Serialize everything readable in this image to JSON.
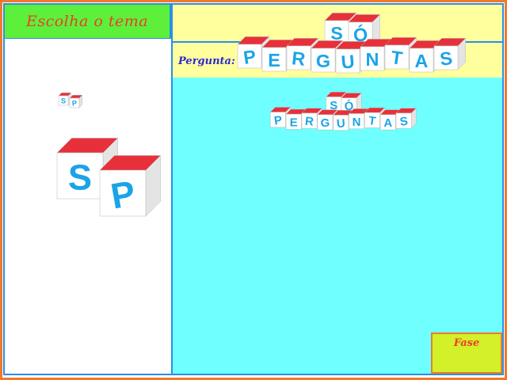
{
  "theme_button": {
    "label": "Escolha o tema"
  },
  "question": {
    "label": "Pergunta:",
    "text": ""
  },
  "phase_button": {
    "label": "Fase"
  },
  "logo": {
    "top_word": [
      "S",
      "Ó"
    ],
    "bottom_word": [
      "P",
      "E",
      "R",
      "G",
      "U",
      "N",
      "T",
      "A",
      "S"
    ]
  },
  "sidebar_cubes": [
    "S",
    "P"
  ],
  "colors": {
    "frame": "#f07a2a",
    "border": "#2a8fe8",
    "theme_bg": "#5df03a",
    "theme_text": "#e8402a",
    "header_bg": "#ffff9e",
    "main_bg": "#6ffffe",
    "phase_bg": "#d4f028",
    "question_text": "#2a2ad0",
    "cube_top": "#e8303a",
    "cube_letter": "#1aa4e8"
  }
}
